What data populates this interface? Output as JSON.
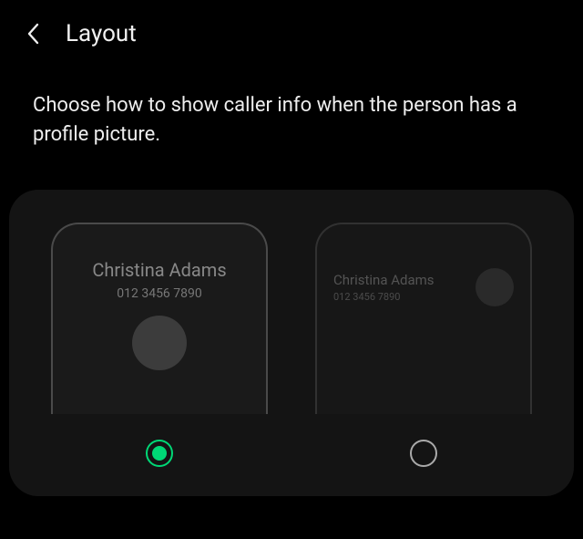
{
  "header": {
    "title": "Layout"
  },
  "description": "Choose how to show caller info when the person has a profile picture.",
  "sample": {
    "name": "Christina Adams",
    "number": "012 3456 7890"
  },
  "options": {
    "centered": {
      "selected": true
    },
    "compact": {
      "selected": false
    }
  },
  "colors": {
    "accent": "#00d876"
  }
}
